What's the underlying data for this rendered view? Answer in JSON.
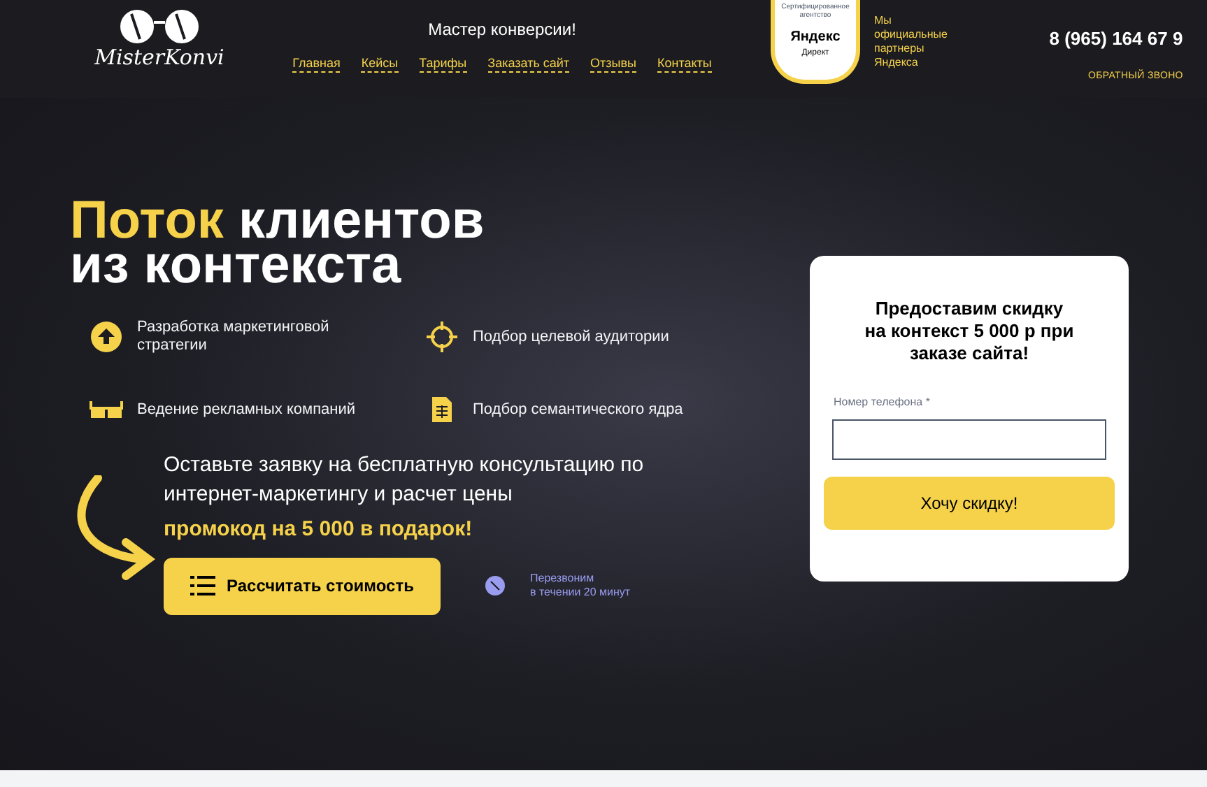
{
  "header": {
    "logo": "MisterKonvi",
    "tagline": "Мастер конверсии!",
    "nav": [
      {
        "label": "Главная"
      },
      {
        "label": "Кейсы"
      },
      {
        "label": "Тарифы"
      },
      {
        "label": "Заказать сайт"
      },
      {
        "label": "Отзывы"
      },
      {
        "label": "Контакты"
      }
    ],
    "badge": {
      "caption": "Сертифицированное агентство",
      "brand": "Яндекс",
      "product": "Директ"
    },
    "partner_text": "Мы официальные партнеры Яндекса",
    "phone": "8 (965) 164 67 9",
    "callback": "ОБРАТНЫЙ ЗВОНО"
  },
  "hero": {
    "title_accent": "Поток",
    "title_rest": "клиентов",
    "title_line2": "из контекста",
    "features": [
      {
        "kind": "arrow",
        "text": "Разработка маркетинговой стратегии"
      },
      {
        "kind": "target",
        "text": "Подбор целевой аудитории"
      },
      {
        "kind": "glasses",
        "text": "Ведение рекламных компаний"
      },
      {
        "kind": "sheet",
        "text": "Подбор семантического ядра"
      }
    ],
    "offer": "Оставьте заявку на бесплатную консультацию по интернет-маркетингу и расчет цены",
    "promo": "промокод на 5 000 в подарок!",
    "cta": "Рассчитать стоимость",
    "callback_note": [
      "Перезвоним",
      "в течении 20 минут"
    ]
  },
  "form": {
    "title": "Предоставим скидку на контекст 5 000 р при заказе сайта!",
    "phone_label": "Номер телефона *",
    "submit": "Хочу скидку!"
  }
}
